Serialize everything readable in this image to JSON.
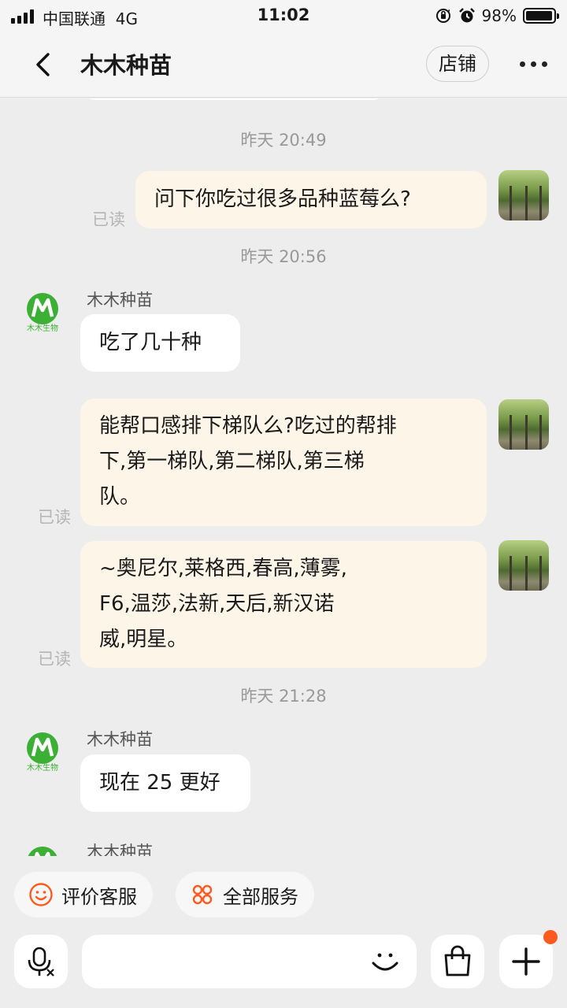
{
  "status_bar": {
    "carrier": "中国联通",
    "network": "4G",
    "time": "11:02",
    "battery": "98%",
    "battery_level": 0.98
  },
  "header": {
    "title": "木木种苗",
    "store_label": "店铺"
  },
  "chat": {
    "timestamps": [
      "昨天 20:49",
      "昨天 20:56",
      "昨天 21:28"
    ],
    "read_label": "已读",
    "shop_name": "木木种苗",
    "shop_logo_text": "木木生物",
    "messages": [
      {
        "from": "me",
        "text": "问下你吃过很多品种蓝莓么?",
        "read": "已读"
      },
      {
        "from": "shop",
        "sender": "木木种苗",
        "text": "吃了几十种"
      },
      {
        "from": "me",
        "lines": [
          "能帮口感排下梯队么?吃过的帮排",
          "下,第一梯队,第二梯队,第三梯",
          "队。"
        ],
        "read": "已读"
      },
      {
        "from": "me",
        "lines": [
          "~奥尼尔,莱格西,春高,薄雾,",
          "F6,温莎,法新,天后,新汉诺",
          "威,明星。"
        ],
        "read": "已读"
      },
      {
        "from": "shop",
        "sender": "木木种苗",
        "text": "现在 25 更好"
      },
      {
        "from": "shop",
        "sender": "木木种苗",
        "text": ""
      }
    ]
  },
  "quick_actions": [
    {
      "label": "评价客服",
      "icon": "smiley-icon"
    },
    {
      "label": "全部服务",
      "icon": "grid-icon"
    }
  ],
  "input_bar": {
    "voice_icon": "voice-input-icon",
    "emoji_icon": "emoji-icon",
    "shop_icon": "shopping-bag-icon",
    "plus_icon": "plus-icon"
  },
  "colors": {
    "background": "#ededed",
    "my_bubble": "#fdf5e8",
    "their_bubble": "#ffffff",
    "accent_orange": "#ff5a1f",
    "shop_logo_green": "#3cb034"
  }
}
